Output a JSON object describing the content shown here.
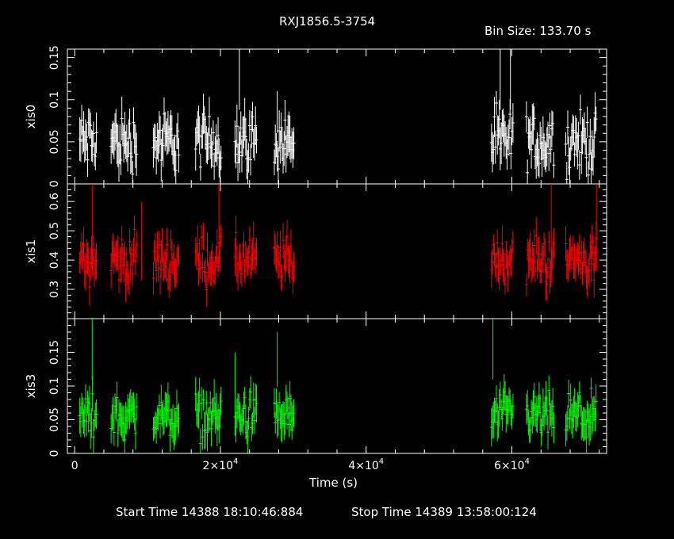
{
  "header": {
    "title": "RXJ1856.5-3754",
    "bin_size": "Bin Size: 133.70 s"
  },
  "footer": {
    "start_time": "Start Time 14388 18:10:46:884",
    "stop_time": "Stop Time 14389 13:58:00:124"
  },
  "chart_data": [
    {
      "type": "scatter",
      "title": "RXJ1856.5-3754",
      "ylabel": "xis0",
      "color": "#ffffff",
      "xlim": [
        -1000,
        73000
      ],
      "ylim": [
        0,
        0.16
      ],
      "yticks": [
        0,
        0.05,
        0.1,
        0.15
      ],
      "yticklabels": [
        "0",
        "0.05",
        "0.1",
        "0.15"
      ],
      "mean": 0.05,
      "spread": 0.025,
      "error": 0.02,
      "spikes": [
        [
          22600,
          0.16
        ],
        [
          27800,
          0.11
        ],
        [
          58400,
          0.16
        ],
        [
          59800,
          0.16
        ]
      ]
    },
    {
      "type": "scatter",
      "ylabel": "xis1",
      "color": "#ff0000",
      "xlim": [
        -1000,
        73000
      ],
      "ylim": [
        0.2,
        0.66
      ],
      "yticks": [
        0.3,
        0.4,
        0.5,
        0.6
      ],
      "yticklabels": [
        "0.3",
        "0.4",
        "0.5",
        "0.6"
      ],
      "mean": 0.4,
      "spread": 0.06,
      "error": 0.05,
      "spikes": [
        [
          2400,
          0.66
        ],
        [
          9200,
          0.6
        ],
        [
          19800,
          0.66
        ],
        [
          65400,
          0.66
        ],
        [
          71600,
          0.66
        ]
      ]
    },
    {
      "type": "scatter",
      "ylabel": "xis3",
      "color": "#00ff00",
      "xlim": [
        -1000,
        73000
      ],
      "ylim": [
        0,
        0.2
      ],
      "yticks": [
        0,
        0.05,
        0.1,
        0.15
      ],
      "yticklabels": [
        "0",
        "0.05",
        "0.1",
        "0.15"
      ],
      "xlabel": "Time (s)",
      "xticks": [
        0,
        20000,
        40000,
        60000
      ],
      "mean": 0.055,
      "spread": 0.025,
      "error": 0.022,
      "spikes": [
        [
          2400,
          0.2
        ],
        [
          22000,
          0.15
        ],
        [
          27800,
          0.18
        ],
        [
          57400,
          0.2
        ]
      ]
    }
  ],
  "segments": [
    [
      700,
      3000
    ],
    [
      5000,
      8600
    ],
    [
      10800,
      14400
    ],
    [
      16600,
      20200
    ],
    [
      22000,
      25000
    ],
    [
      27400,
      30200
    ],
    [
      57200,
      60200
    ],
    [
      62000,
      65800
    ],
    [
      67400,
      71600
    ]
  ],
  "x_tick_labels": [
    {
      "x": 0,
      "mantissa": "0",
      "exponent": ""
    },
    {
      "x": 20000,
      "mantissa": "2×10",
      "exponent": "4"
    },
    {
      "x": 40000,
      "mantissa": "4×10",
      "exponent": "4"
    },
    {
      "x": 60000,
      "mantissa": "6×10",
      "exponent": "4"
    }
  ]
}
